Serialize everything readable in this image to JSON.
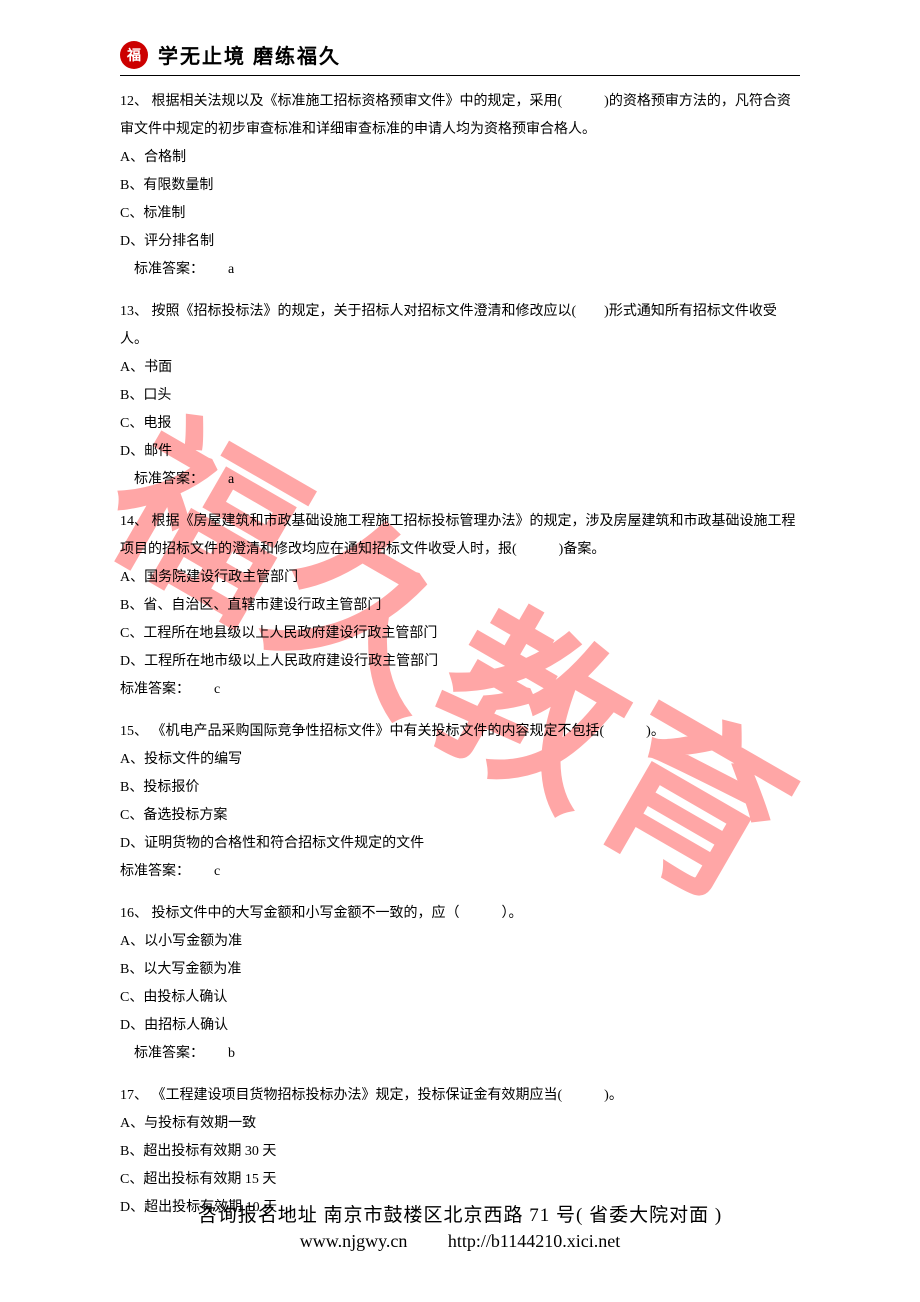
{
  "watermark": "福久教育",
  "header": {
    "logo_char": "福",
    "title": "学无止境  磨练福久"
  },
  "questions": [
    {
      "num": "12、",
      "text": "根据相关法规以及《标准施工招标资格预审文件》中的规定，采用(　　　)的资格预审方法的，凡符合资审文件中规定的初步审查标准和详细审查标准的申请人均为资格预审合格人。",
      "options": [
        "A、合格制",
        "B、有限数量制",
        "C、标准制",
        "D、评分排名制"
      ],
      "answer_label": "标准答案：",
      "answer": "a",
      "answer_indent": true
    },
    {
      "num": "13、",
      "text": "按照《招标投标法》的规定，关于招标人对招标文件澄清和修改应以(　　)形式通知所有招标文件收受人。",
      "options": [
        "A、书面",
        "B、口头",
        "C、电报",
        "D、邮件"
      ],
      "answer_label": "标准答案：",
      "answer": "a",
      "answer_indent": true
    },
    {
      "num": "14、",
      "text": "根据《房屋建筑和市政基础设施工程施工招标投标管理办法》的规定，涉及房屋建筑和市政基础设施工程项目的招标文件的澄清和修改均应在通知招标文件收受人时，报(　　　)备案。",
      "options": [
        "A、国务院建设行政主管部门",
        "B、省、自治区、直辖市建设行政主管部门",
        "C、工程所在地县级以上人民政府建设行政主管部门",
        "D、工程所在地市级以上人民政府建设行政主管部门"
      ],
      "answer_label": "标准答案：",
      "answer": "c",
      "answer_indent": false
    },
    {
      "num": "15、",
      "text": "《机电产品采购国际竞争性招标文件》中有关投标文件的内容规定不包括(　　　)。",
      "options": [
        "A、投标文件的编写",
        "B、投标报价",
        "C、备选投标方案",
        "D、证明货物的合格性和符合招标文件规定的文件"
      ],
      "answer_label": "标准答案：",
      "answer": "c",
      "answer_indent": false
    },
    {
      "num": "16、",
      "text": "投标文件中的大写金额和小写金额不一致的，应（　　　）。",
      "options": [
        "A、以小写金额为准",
        "B、以大写金额为准",
        "C、由投标人确认",
        "D、由招标人确认"
      ],
      "answer_label": "标准答案：",
      "answer": "b",
      "answer_indent": true
    },
    {
      "num": "17、",
      "text": "《工程建设项目货物招标投标办法》规定，投标保证金有效期应当(　　　)。",
      "options": [
        "A、与投标有效期一致",
        "B、超出投标有效期 30 天",
        "C、超出投标有效期 15 天",
        "D、超出投标有效期 10 天"
      ],
      "answer_label": "",
      "answer": "",
      "answer_indent": false
    }
  ],
  "footer": {
    "address": "咨询报名地址 南京市鼓楼区北京西路 71 号( 省委大院对面 )",
    "url1": "www.njgwy.cn",
    "url2": "http://b1144210.xici.net"
  }
}
